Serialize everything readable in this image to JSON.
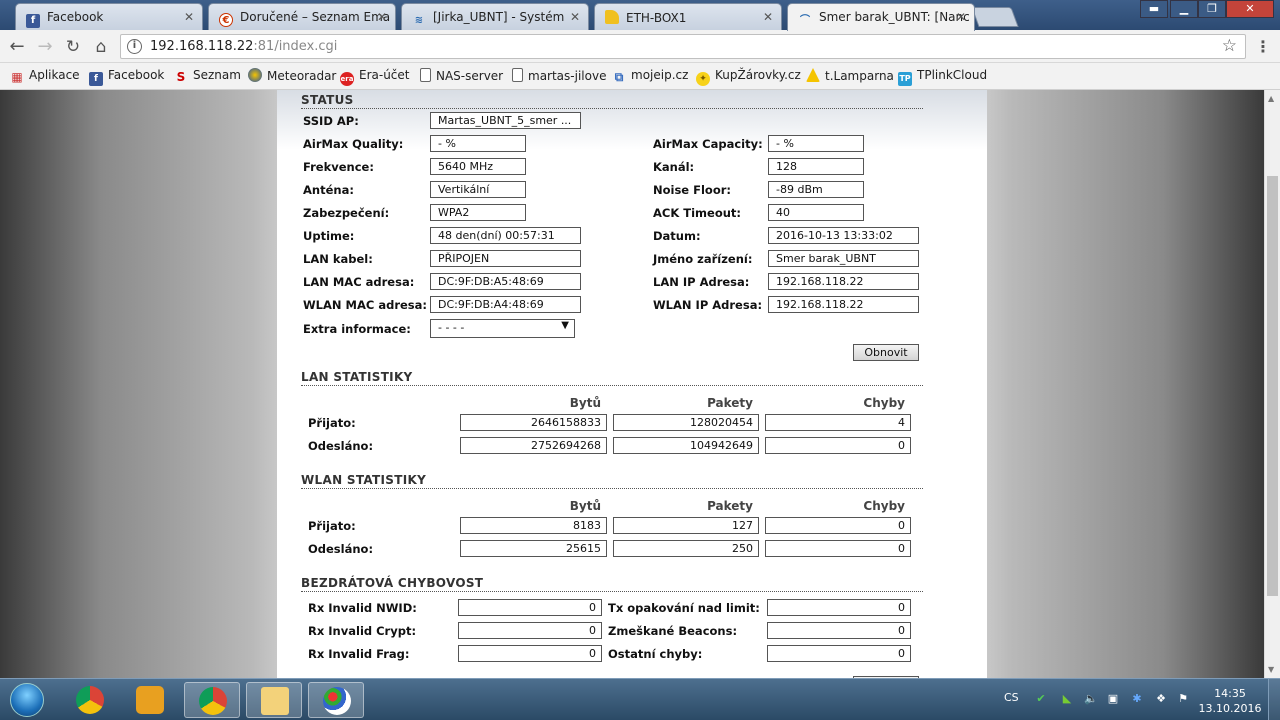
{
  "browser": {
    "tabs": [
      {
        "label": "Facebook",
        "icon": "facebook-icon"
      },
      {
        "label": "Doručené – Seznam Ema",
        "icon": "seznam-email-icon"
      },
      {
        "label": "[Jirka_UBNT] - Systém",
        "icon": "ubnt-icon"
      },
      {
        "label": "ETH-BOX1",
        "icon": "document-icon"
      },
      {
        "label": "Smer barak_UBNT: [Nanc",
        "icon": "ubnt-icon"
      }
    ],
    "url_host": "192.168.118.22",
    "url_rest": ":81/index.cgi",
    "bookmarks": [
      {
        "label": "Aplikace",
        "icon": "apps-grid-icon"
      },
      {
        "label": "Facebook",
        "icon": "facebook-icon"
      },
      {
        "label": "Seznam",
        "icon": "seznam-icon"
      },
      {
        "label": "Meteoradar",
        "icon": "meteoradar-icon"
      },
      {
        "label": "Era-účet",
        "icon": "era-icon"
      },
      {
        "label": "NAS-server",
        "icon": "document-icon"
      },
      {
        "label": "martas-jilove",
        "icon": "document-icon"
      },
      {
        "label": "mojeip.cz",
        "icon": "network-icon"
      },
      {
        "label": "KupŽárovky.cz",
        "icon": "bulb-icon"
      },
      {
        "label": "t.Lamparna",
        "icon": "lamp-icon"
      },
      {
        "label": "TPlinkCloud",
        "icon": "tplink-icon"
      }
    ]
  },
  "status": {
    "title": "STATUS",
    "ssid_label": "SSID AP:",
    "ssid_value": "Martas_UBNT_5_smer ...",
    "left": [
      {
        "label": "AirMax Quality:",
        "value": "- %"
      },
      {
        "label": "Frekvence:",
        "value": "5640 MHz"
      },
      {
        "label": "Anténa:",
        "value": "Vertikální"
      },
      {
        "label": "Zabezpečení:",
        "value": "WPA2"
      },
      {
        "label": "Uptime:",
        "value": "48 den(dní) 00:57:31"
      },
      {
        "label": "LAN kabel:",
        "value": "PŘIPOJEN"
      },
      {
        "label": "LAN MAC adresa:",
        "value": "DC:9F:DB:A5:48:69"
      },
      {
        "label": "WLAN MAC adresa:",
        "value": "DC:9F:DB:A4:48:69"
      }
    ],
    "right": [
      {
        "label": "AirMax Capacity:",
        "value": "- %"
      },
      {
        "label": "Kanál:",
        "value": "128"
      },
      {
        "label": "Noise Floor:",
        "value": "-89 dBm"
      },
      {
        "label": "ACK Timeout:",
        "value": "40"
      },
      {
        "label": "Datum:",
        "value": "2016-10-13 13:33:02"
      },
      {
        "label": "Jméno zařízení:",
        "value": " Smer barak_UBNT"
      },
      {
        "label": "LAN IP Adresa:",
        "value": "192.168.118.22"
      },
      {
        "label": "WLAN IP Adresa:",
        "value": "192.168.118.22"
      }
    ],
    "extra_label": "Extra informace:",
    "extra_value": "- - - -",
    "refresh_button": "Obnovit"
  },
  "lan_stats": {
    "title": "LAN STATISTIKY",
    "headers": [
      "Bytů",
      "Pakety",
      "Chyby"
    ],
    "rows": [
      {
        "label": "Přijato:",
        "values": [
          "2646158833",
          "128020454",
          "4"
        ]
      },
      {
        "label": "Odesláno:",
        "values": [
          "2752694268",
          "104942649",
          "0"
        ]
      }
    ]
  },
  "wlan_stats": {
    "title": "WLAN STATISTIKY",
    "headers": [
      "Bytů",
      "Pakety",
      "Chyby"
    ],
    "rows": [
      {
        "label": "Přijato:",
        "values": [
          "8183",
          "127",
          "0"
        ]
      },
      {
        "label": "Odesláno:",
        "values": [
          "25615",
          "250",
          "0"
        ]
      }
    ]
  },
  "wireless_errors": {
    "title": "BEZDRÁTOVÁ CHYBOVOST",
    "left": [
      {
        "label": "Rx Invalid NWID:",
        "value": "0"
      },
      {
        "label": "Rx Invalid Crypt:",
        "value": "0"
      },
      {
        "label": "Rx Invalid Frag:",
        "value": "0"
      }
    ],
    "right": [
      {
        "label": "Tx opakování nad limit:",
        "value": "0"
      },
      {
        "label": "Zmeškané Beacons:",
        "value": "0"
      },
      {
        "label": "Ostatní chyby:",
        "value": "0"
      }
    ]
  },
  "taskbar": {
    "lang": "CS",
    "time": "14:35",
    "date": "13.10.2016"
  }
}
